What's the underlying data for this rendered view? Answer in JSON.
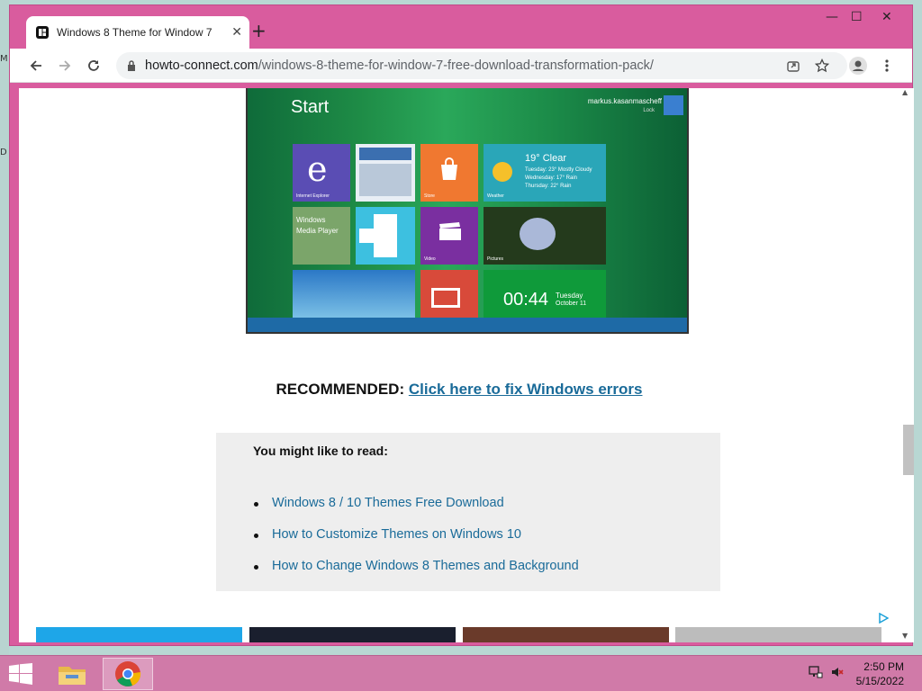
{
  "desktop": {
    "glyph_top": "M",
    "glyph_mid": "D"
  },
  "browser": {
    "tab_title": "Windows 8 Theme for Window 7",
    "tab_close": "✕",
    "new_tab": "+",
    "minimize": "—",
    "maximize": "☐",
    "close": "✕",
    "url_domain": "howto-connect.com",
    "url_path": "/windows-8-theme-for-window-7-free-download-transformation-pack/"
  },
  "win8_image": {
    "start_label": "Start",
    "user_name": "markus.kasanmascheff",
    "lock_label": "Lock",
    "tiles": {
      "ie_label": "Internet Explorer",
      "store_label": "Store",
      "weather_temp": "19° Clear",
      "weather_line1": "Tuesday: 23° Mostly Cloudy",
      "weather_line2": "Wednesday: 17° Rain",
      "weather_line3": "Thursday: 22° Rain",
      "weather_label": "Weather",
      "wmp_line1": "Windows",
      "wmp_line2": "Media Player",
      "video_label": "Video",
      "pictures_label": "Pictures",
      "clock_time": "00:44",
      "clock_day": "Tuesday",
      "clock_date": "October 11"
    }
  },
  "article": {
    "recommended_label": "RECOMMENDED:",
    "recommended_link": "Click here to fix Windows errors",
    "read_heading": "You might like to read:",
    "read_links": [
      "Windows 8 / 10 Themes Free Download",
      "How to Customize Themes on Windows 10",
      "How to Change Windows 8 Themes and Background"
    ]
  },
  "taskbar": {
    "time": "2:50 PM",
    "date": "5/15/2022"
  },
  "colors": {
    "frame": "#d95c9e",
    "link": "#1a6b99",
    "taskbar": "#d07aa8"
  },
  "icons": [
    "back-arrow-icon",
    "forward-arrow-icon",
    "reload-icon",
    "lock-icon",
    "share-icon",
    "star-icon",
    "profile-icon",
    "more-icon",
    "windows-start-icon",
    "file-explorer-icon",
    "chrome-icon",
    "network-icon",
    "volume-muted-icon"
  ]
}
